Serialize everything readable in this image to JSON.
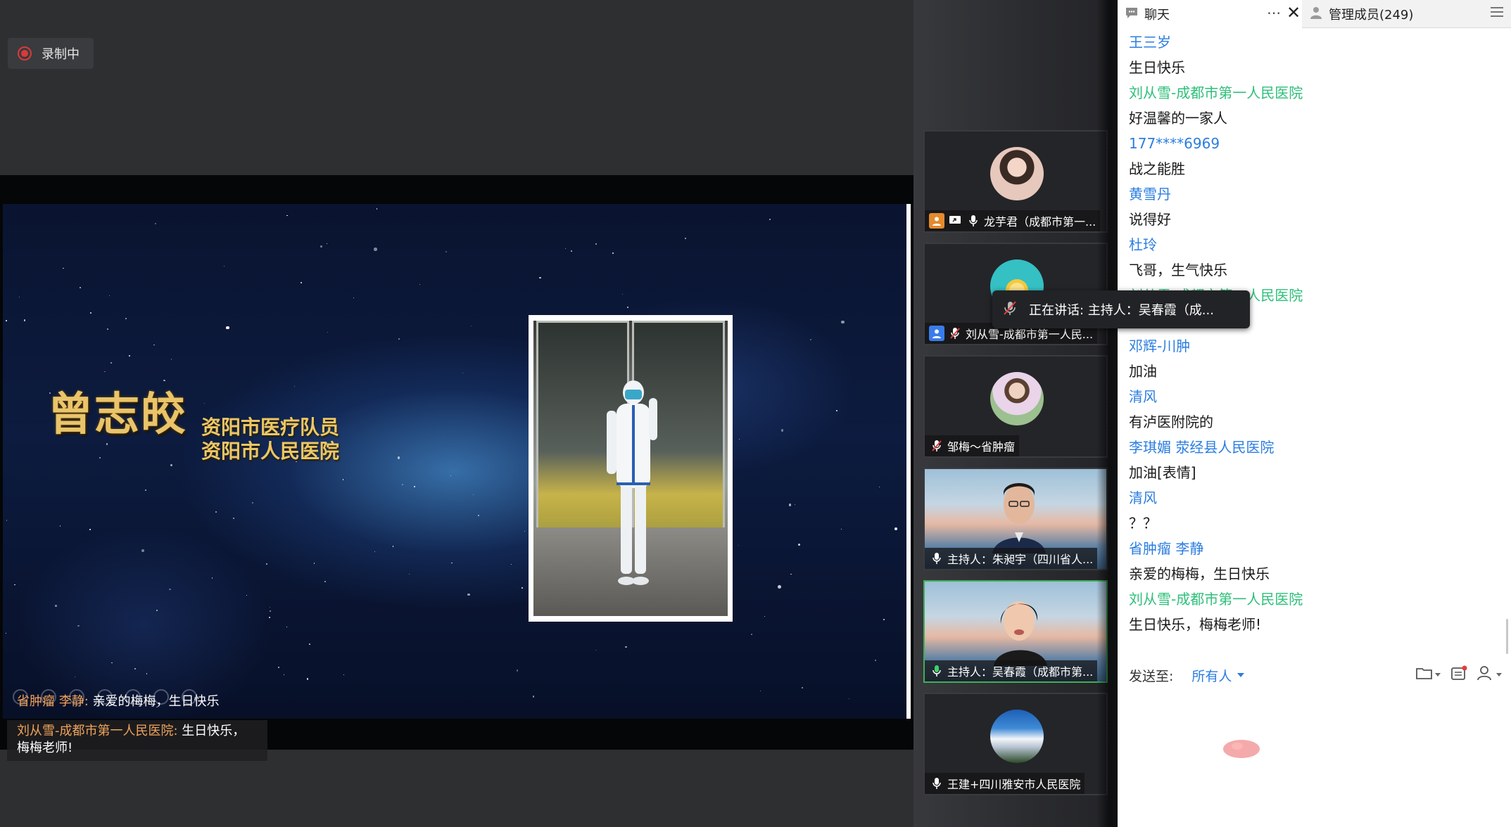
{
  "recording": {
    "label": "录制中"
  },
  "slide": {
    "name": "曾志皎",
    "subtitle_line1": "资阳市医疗队员",
    "subtitle_line2": "资阳市人民医院"
  },
  "danmu": [
    {
      "sender": "省肿瘤 李静",
      "text": "亲爱的梅梅，生日快乐"
    },
    {
      "sender": "刘从雪-成都市第一人民医院",
      "text": "生日快乐，梅梅老师!"
    }
  ],
  "participants": [
    {
      "name": "龙芋君（成都市第一...",
      "icons": [
        "user-icon",
        "screen-share-icon",
        "mic-icon"
      ],
      "avatar": "woman-photo-avatar"
    },
    {
      "name": "刘从雪-成都市第一人民...",
      "icons": [
        "user-icon",
        "mic-muted-icon"
      ],
      "avatar": "lemon-avatar"
    },
    {
      "name": "邹梅～省肿瘤",
      "icons": [
        "mic-muted-icon"
      ],
      "avatar": "girl-photo-avatar"
    },
    {
      "name": "主持人：朱昶宇（四川省人...",
      "icons": [
        "mic-icon"
      ],
      "avatar": "video-feed"
    },
    {
      "name": "主持人：吴春霞（成都市第...",
      "icons": [
        "mic-active-icon"
      ],
      "avatar": "video-feed"
    },
    {
      "name": "王建+四川雅安市人民医院",
      "icons": [
        "mic-icon"
      ],
      "avatar": "snow-mountain-avatar"
    }
  ],
  "speaking_tooltip": {
    "text": "正在讲话: 主持人：吴春霞（成..."
  },
  "chat": {
    "tab_chat": "聊天",
    "tab_members": "管理成员(249)",
    "messages": [
      {
        "kind": "sender",
        "color": "blue",
        "text": "王三岁"
      },
      {
        "kind": "text",
        "text": "生日快乐"
      },
      {
        "kind": "sender",
        "color": "green",
        "text": "刘从雪-成都市第一人民医院"
      },
      {
        "kind": "text",
        "text": "好温馨的一家人"
      },
      {
        "kind": "sender",
        "color": "blue",
        "text": "177****6969"
      },
      {
        "kind": "text",
        "text": "战之能胜"
      },
      {
        "kind": "sender",
        "color": "blue",
        "text": "黄雪丹"
      },
      {
        "kind": "text",
        "text": "说得好"
      },
      {
        "kind": "sender",
        "color": "blue",
        "text": "杜玲"
      },
      {
        "kind": "text",
        "text": "飞哥，生气快乐"
      },
      {
        "kind": "sender",
        "color": "green",
        "text": "刘从雪-成都市第一人民医院"
      },
      {
        "kind": "text",
        "text": ""
      },
      {
        "kind": "sender",
        "color": "blue",
        "text": "邓辉-川肿"
      },
      {
        "kind": "text",
        "text": "加油"
      },
      {
        "kind": "sender",
        "color": "blue",
        "text": "清风"
      },
      {
        "kind": "text",
        "text": "有泸医附院的"
      },
      {
        "kind": "sender",
        "color": "blue",
        "text": "李琪媚 荥经县人民医院"
      },
      {
        "kind": "text",
        "text": "加油[表情]"
      },
      {
        "kind": "sender",
        "color": "blue",
        "text": "清风"
      },
      {
        "kind": "text",
        "text": "？？"
      },
      {
        "kind": "sender",
        "color": "blue",
        "text": "省肿瘤 李静"
      },
      {
        "kind": "text",
        "text": "亲爱的梅梅，生日快乐"
      },
      {
        "kind": "sender",
        "color": "green",
        "text": "刘从雪-成都市第一人民医院"
      },
      {
        "kind": "text",
        "text": "生日快乐，梅梅老师!"
      }
    ],
    "send_label": "发送至:",
    "send_target": "所有人"
  },
  "colors": {
    "sender_blue": "#2b7de0",
    "sender_green": "#2ebf7a",
    "active_tile": "#3fae58",
    "recording_red": "#d93a3a"
  }
}
